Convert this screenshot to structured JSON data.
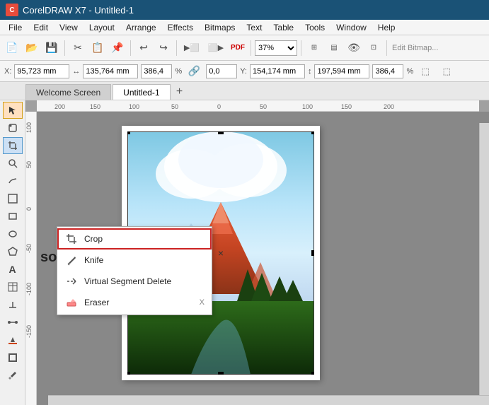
{
  "titleBar": {
    "appName": "CorelDRAW X7 - Untitled-1",
    "icon": "C"
  },
  "menuBar": {
    "items": [
      "File",
      "Edit",
      "View",
      "Layout",
      "Arrange",
      "Effects",
      "Bitmaps",
      "Text",
      "Table",
      "Tools",
      "Window",
      "Help"
    ]
  },
  "toolbar": {
    "zoom": "37%",
    "xCoord": "X: 95,723 mm",
    "yCoord": "Y: 154,174 mm",
    "width": "135,764 mm",
    "height": "197,594 mm",
    "w_val": "386,4",
    "h_val": "386,4",
    "angle": "0,0",
    "editBitmap": "Edit Bitmap..."
  },
  "tabs": {
    "items": [
      "Welcome Screen",
      "Untitled-1"
    ],
    "active": "Untitled-1",
    "add_label": "+"
  },
  "dropdownMenu": {
    "items": [
      {
        "label": "Crop",
        "icon": "crop",
        "shortcut": "",
        "highlighted": true
      },
      {
        "label": "Knife",
        "icon": "knife",
        "shortcut": ""
      },
      {
        "label": "Virtual Segment Delete",
        "icon": "vsd",
        "shortcut": ""
      },
      {
        "label": "Eraser",
        "icon": "eraser",
        "shortcut": "X"
      }
    ]
  },
  "canvas": {
    "watermark": "sobat-tutorial.com",
    "centerMark": "×"
  },
  "leftTools": [
    "↖",
    "⤢",
    "✂",
    "◈",
    "▷",
    "🔲",
    "⬟",
    "⬭",
    "🗒",
    "A",
    "📝",
    "🔍",
    "🪣",
    "✏",
    "💧",
    "⬜",
    "○"
  ]
}
